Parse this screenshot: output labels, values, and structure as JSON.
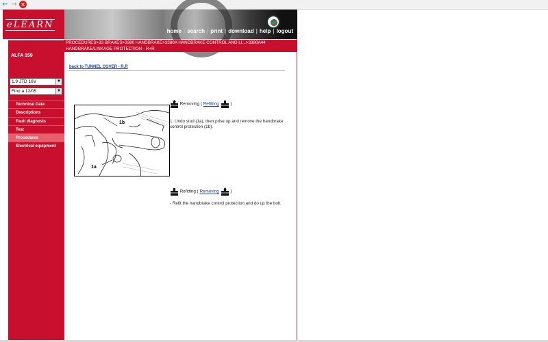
{
  "header": {
    "logo": "eLEARN",
    "nav": [
      "home",
      "search",
      "print",
      "download",
      "help",
      "logout"
    ]
  },
  "breadcrumb": {
    "line1": "PROCEDURES>33 BRAKES>3380 HANDBRAKE>3380A HANDBRAKE CONTROL AND LI...>3380A44",
    "line2": "HANDBRAKE/LINKAGE PROTECTION - R+R"
  },
  "sidebar": {
    "model": "ALFA 159",
    "engine_select": "1.9 JTD 16V",
    "date_select": "Fino a 12/05",
    "menu": [
      "Technical Data",
      "Descriptions",
      "Fault diagnosis",
      "Test",
      "Procedures",
      "Electrical equipment"
    ],
    "active_index": 4
  },
  "content": {
    "back_link": "back to TUNNEL COVER - R.R",
    "removing_label": "Removing (",
    "removing_link": "Refitting",
    "close_paren": ")",
    "step1": "1. Undo stud (1a), then prise up and remove the handbrake control protection (1b).",
    "refitting_label": "Refitting (",
    "refitting_link": "Removing",
    "refit_text": "- Refit the handbrake control protection and do up the bolt.",
    "diagram_labels": {
      "a": "1a",
      "b": "1b"
    }
  }
}
